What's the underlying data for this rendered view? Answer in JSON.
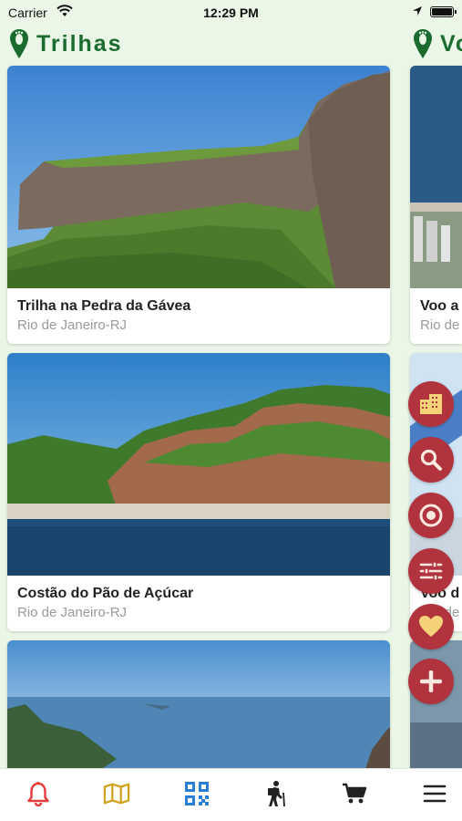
{
  "status_bar": {
    "carrier": "Carrier",
    "time": "12:29 PM"
  },
  "sections": [
    {
      "title": "Trilhas",
      "icon": "footprint-pin-icon"
    },
    {
      "title": "Vo",
      "icon": "footprint-pin-icon"
    }
  ],
  "trails": [
    {
      "title": "Trilha na Pedra da Gávea",
      "location": "Rio de Janeiro-RJ"
    },
    {
      "title": "Costão do Pão de Açúcar",
      "location": "Rio de Janeiro-RJ"
    },
    {
      "title": "",
      "location": ""
    }
  ],
  "flights": [
    {
      "title": "Voo a",
      "location": "Rio de"
    },
    {
      "title": "Voo d",
      "location": "Rio de"
    }
  ],
  "fab_buttons": [
    "city-icon",
    "search-icon",
    "target-icon",
    "filter-icon",
    "heart-icon",
    "plus-icon"
  ],
  "tabbar": [
    "bell-icon",
    "map-icon",
    "qr-code-icon",
    "hiker-icon",
    "cart-icon",
    "menu-icon"
  ],
  "colors": {
    "background": "#eaf7e6",
    "header_green": "#1a6b2e",
    "fab_red": "#b1333e",
    "map_gold": "#d1a21b",
    "qr_blue": "#2a7fd6",
    "bell_red": "#e53a3a"
  }
}
